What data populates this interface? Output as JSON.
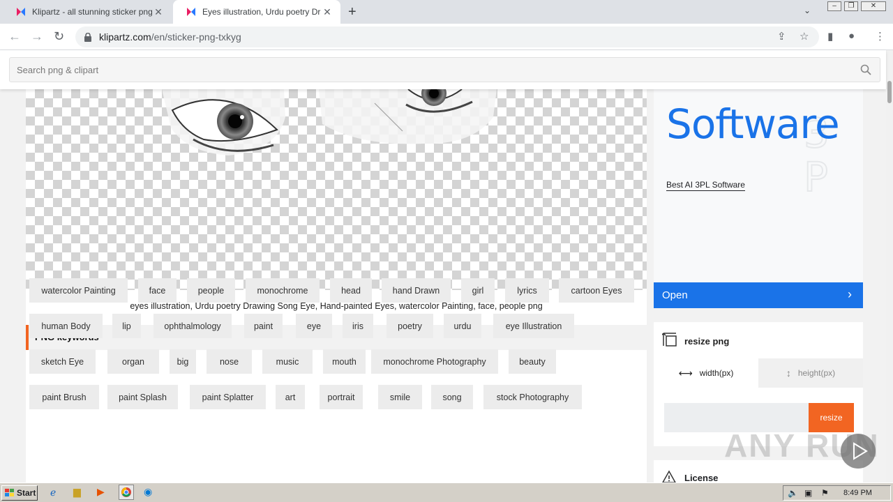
{
  "browser": {
    "tabs": [
      {
        "title": "Klipartz - all stunning sticker png images"
      },
      {
        "title": "Eyes illustration, Urdu poetry Drawing Song Eye"
      }
    ],
    "url_host": "klipartz.com",
    "url_path": "/en/sticker-png-txkyg"
  },
  "search": {
    "placeholder": "Search png & clipart"
  },
  "main": {
    "caption": "eyes illustration, Urdu poetry Drawing Song Eye, Hand-painted Eyes, watercolor Painting, face, people png",
    "keywords_heading": "PNG keywords",
    "keywords": [
      "watercolor Painting",
      "face",
      "people",
      "monochrome",
      "head",
      "hand Drawn",
      "girl",
      "lyrics",
      "cartoon Eyes",
      "human Body",
      "lip",
      "ophthalmology",
      "paint",
      "eye",
      "iris",
      "poetry",
      "urdu",
      "eye Illustration",
      "sketch Eye",
      "organ",
      "big",
      "nose",
      "music",
      "mouth",
      "monochrome Photography",
      "beauty",
      "paint Brush",
      "paint Splash",
      "paint Splatter",
      "art",
      "portrait",
      "smile",
      "song",
      "stock Photography"
    ]
  },
  "ad": {
    "headline": "Software",
    "sub": "Best AI 3PL Software",
    "open_label": "Open",
    "accent": "#1a73e8"
  },
  "resize": {
    "title": "resize png",
    "width_tab": "width(px)",
    "height_tab": "height(px)",
    "button": "resize",
    "accent": "#f26522"
  },
  "license": {
    "title": "License"
  },
  "taskbar": {
    "start": "Start",
    "clock": "8:49 PM"
  },
  "watermark": "ANY RUN"
}
